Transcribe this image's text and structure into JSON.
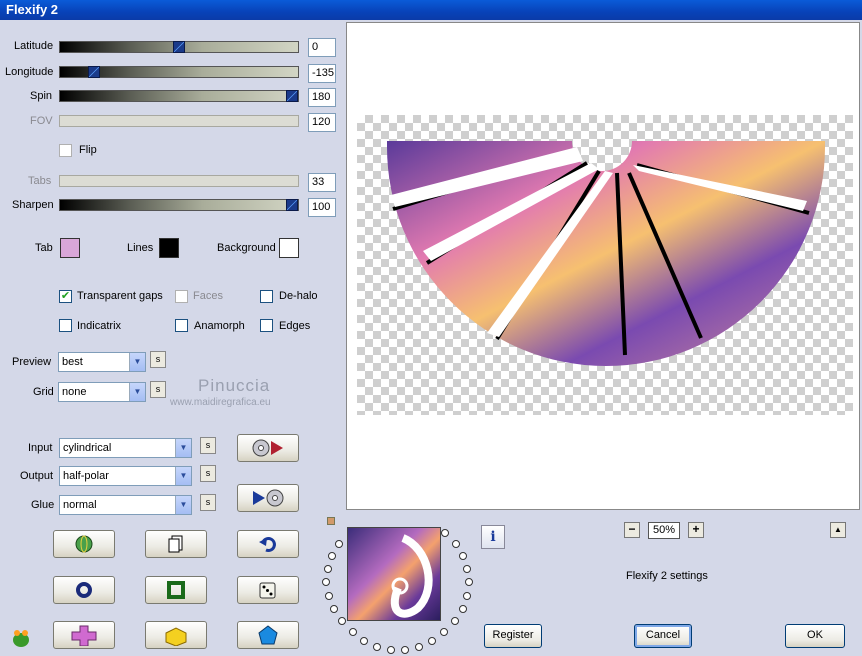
{
  "window": {
    "title": "Flexify 2"
  },
  "params": {
    "latitude": {
      "label": "Latitude",
      "value": "0",
      "level": 0.5
    },
    "longitude": {
      "label": "Longitude",
      "value": "-135",
      "level": 0.125
    },
    "spin": {
      "label": "Spin",
      "value": "180",
      "level": 1.0
    },
    "fov": {
      "label": "FOV",
      "value": "120"
    },
    "flip": {
      "label": "Flip",
      "checked": false
    },
    "tabs": {
      "label": "Tabs",
      "value": "33"
    },
    "sharpen": {
      "label": "Sharpen",
      "value": "100",
      "level": 1.0
    }
  },
  "colors": {
    "tab_label": "Tab",
    "tab_color": "#d9a7d9",
    "lines_label": "Lines",
    "lines_color": "#000000",
    "background_label": "Background",
    "background_color": "#ffffff"
  },
  "options": {
    "transparent_gaps": {
      "label": "Transparent gaps",
      "checked": true
    },
    "faces": {
      "label": "Faces",
      "checked": false
    },
    "dehalo": {
      "label": "De-halo",
      "checked": false
    },
    "indicatrix": {
      "label": "Indicatrix",
      "checked": false
    },
    "anamorph": {
      "label": "Anamorph",
      "checked": false
    },
    "edges": {
      "label": "Edges",
      "checked": false
    }
  },
  "preview_settings": {
    "preview_label": "Preview",
    "preview_value": "best",
    "grid_label": "Grid",
    "grid_value": "none",
    "s_label": "s"
  },
  "projection": {
    "input_label": "Input",
    "input_value": "cylindrical",
    "output_label": "Output",
    "output_value": "half-polar",
    "glue_label": "Glue",
    "glue_value": "normal"
  },
  "watermark": {
    "name": "Pinuccia",
    "site": "www.maidiregrafica.eu"
  },
  "zoom": {
    "minus": "−",
    "value": "50%",
    "plus": "+"
  },
  "info": {
    "symbol": "i",
    "settings_text": "Flexify 2 settings"
  },
  "scroll_up": "▲",
  "buttons": {
    "register": "Register",
    "cancel": "Cancel",
    "ok": "OK"
  }
}
